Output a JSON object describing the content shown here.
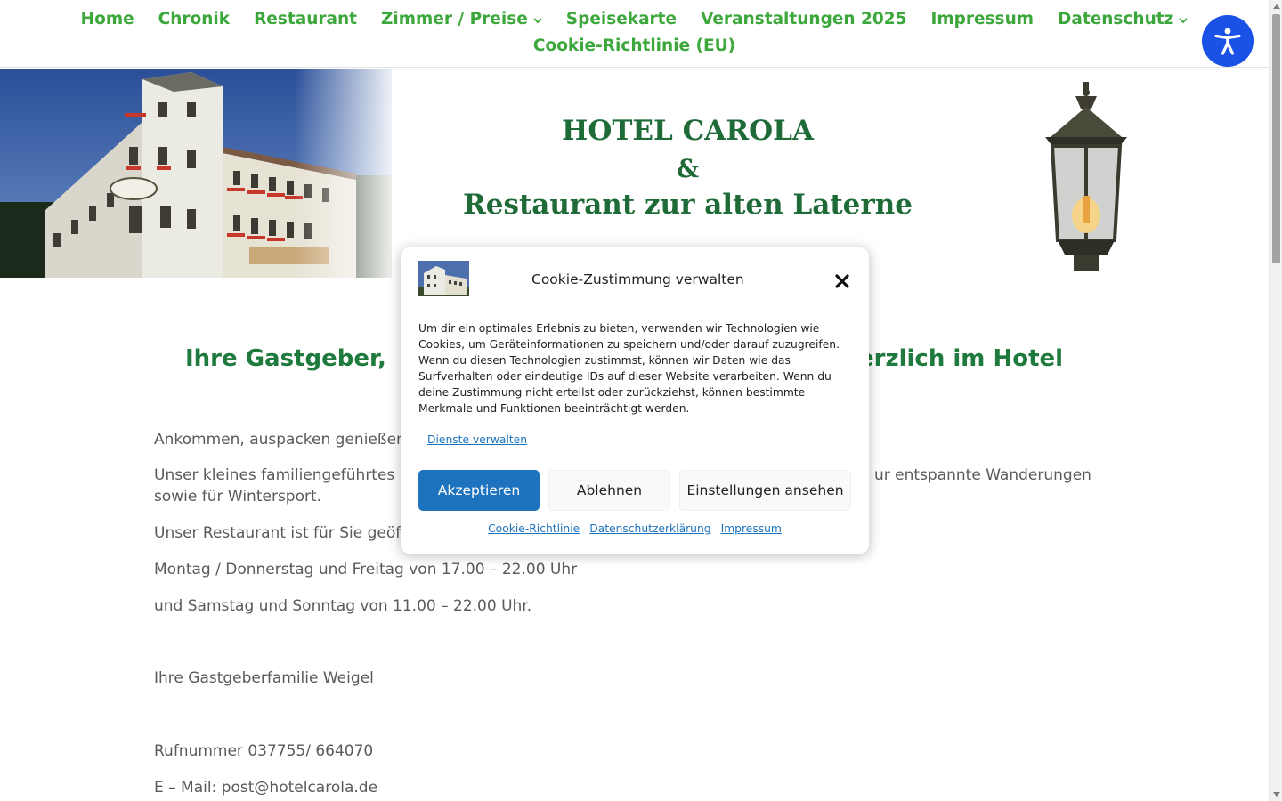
{
  "nav": {
    "items": [
      {
        "label": "Home"
      },
      {
        "label": "Chronik"
      },
      {
        "label": "Restaurant"
      },
      {
        "label": "Zimmer / Preise"
      },
      {
        "label": "Speisekarte"
      },
      {
        "label": "Veranstaltungen 2025"
      },
      {
        "label": "Impressum"
      },
      {
        "label": "Datenschutz"
      },
      {
        "label": "Cookie-Richtlinie (EU)"
      }
    ],
    "color": "#3ca83c"
  },
  "hero": {
    "title_line1": "HOTEL CAROLA",
    "title_line2": "&",
    "title_line3": "Restaurant zur alten Laterne",
    "title_color": "#1e6b37"
  },
  "content": {
    "heading_left": "Ihre Gastgeber,",
    "heading_right": "erzlich im Hotel",
    "p1": "Ankommen, auspacken genießen",
    "p2_left": "Unser kleines familiengeführtes",
    "p2_right": "ur entspannte Wanderungen",
    "p2_line2": "sowie für Wintersport.",
    "p3": "Unser Restaurant ist für Sie geöf",
    "p4": "Montag / Donnerstag und Freitag von 17.00 – 22.00 Uhr",
    "p5": "und Samstag und Sonntag von 11.00 – 22.00 Uhr.",
    "p6": "Ihre Gastgeberfamilie Weigel",
    "p7": "Rufnummer  037755/ 664070",
    "p8": "E – Mail: post@hotelcarola.de"
  },
  "cookie_modal": {
    "title": "Cookie-Zustimmung verwalten",
    "body": "Um dir ein optimales Erlebnis zu bieten, verwenden wir Technologien wie Cookies, um Geräteinformationen zu speichern und/oder darauf zuzugreifen. Wenn du diesen Technologien zustimmst, können wir Daten wie das Surfverhalten oder eindeutige IDs auf dieser Website verarbeiten. Wenn du deine Zustimmung nicht erteilst oder zurückziehst, können bestimmte Merkmale und Funktionen beeinträchtigt werden.",
    "manage_link": "Dienste verwalten",
    "accept_label": "Akzeptieren",
    "deny_label": "Ablehnen",
    "settings_label": "Einstellungen ansehen",
    "links": {
      "cookie_policy": "Cookie-Richtlinie",
      "privacy": "Datenschutzerklärung",
      "imprint": "Impressum"
    },
    "accent": "#1e73be"
  },
  "accessibility": {
    "icon": "accessibility-icon",
    "color": "#1a52e8"
  }
}
